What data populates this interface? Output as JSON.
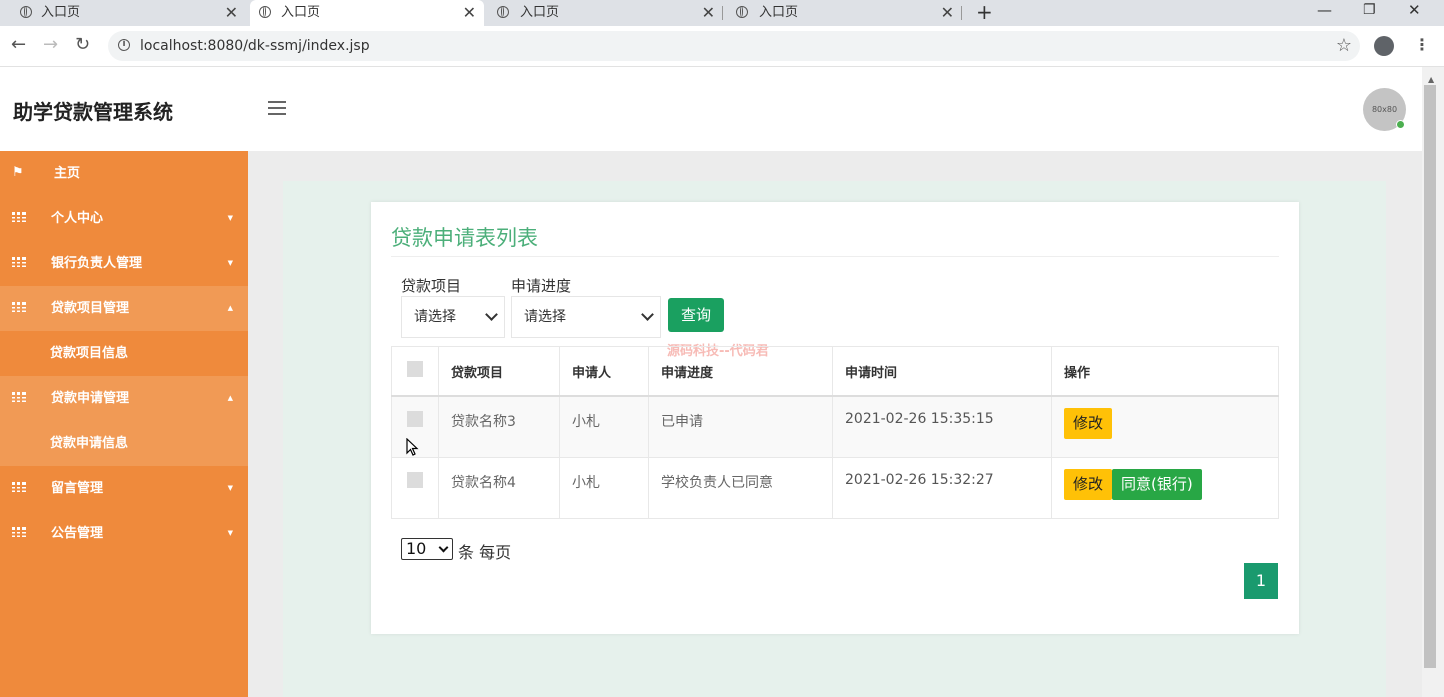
{
  "browser": {
    "tabs": [
      {
        "title": "入口页"
      },
      {
        "title": "入口页"
      },
      {
        "title": "入口页"
      },
      {
        "title": "入口页"
      }
    ],
    "url": "localhost:8080/dk-ssmj/index.jsp"
  },
  "header": {
    "title": "助学贷款管理系统",
    "avatar_text": "80x80"
  },
  "sidebar": {
    "items": [
      {
        "label": "主页",
        "icon": "flag-icon"
      },
      {
        "label": "个人中心",
        "icon": "grid-icon"
      },
      {
        "label": "银行负责人管理",
        "icon": "grid-icon"
      },
      {
        "label": "贷款项目管理",
        "icon": "grid-icon",
        "sub": "贷款项目信息"
      },
      {
        "label": "贷款申请管理",
        "icon": "grid-icon",
        "sub": "贷款申请信息"
      },
      {
        "label": "留言管理",
        "icon": "grid-icon"
      },
      {
        "label": "公告管理",
        "icon": "grid-icon"
      }
    ]
  },
  "main": {
    "title": "贷款申请表列表",
    "filters": {
      "project_label": "贷款项目",
      "project_value": "请选择",
      "progress_label": "申请进度",
      "progress_value": "请选择",
      "query_label": "查询"
    },
    "watermark": "源码科技--代码君",
    "table": {
      "columns": [
        "贷款项目",
        "申请人",
        "申请进度",
        "申请时间",
        "操作"
      ],
      "rows": [
        {
          "project": "贷款名称3",
          "applicant": "小札",
          "progress": "已申请",
          "time": "2021-02-26 15:35:15",
          "actions": [
            "修改"
          ]
        },
        {
          "project": "贷款名称4",
          "applicant": "小札",
          "progress": "学校负责人已同意",
          "time": "2021-02-26 15:32:27",
          "actions": [
            "修改",
            "同意(银行)"
          ]
        }
      ]
    },
    "pagination": {
      "page_size": "10",
      "per_page_text": "条 每页",
      "current_page": "1"
    }
  },
  "colors": {
    "sidebar": "#ef8a3c",
    "accent_green": "#1aa060",
    "edit_button": "#ffc107",
    "agree_button": "#28a745"
  }
}
